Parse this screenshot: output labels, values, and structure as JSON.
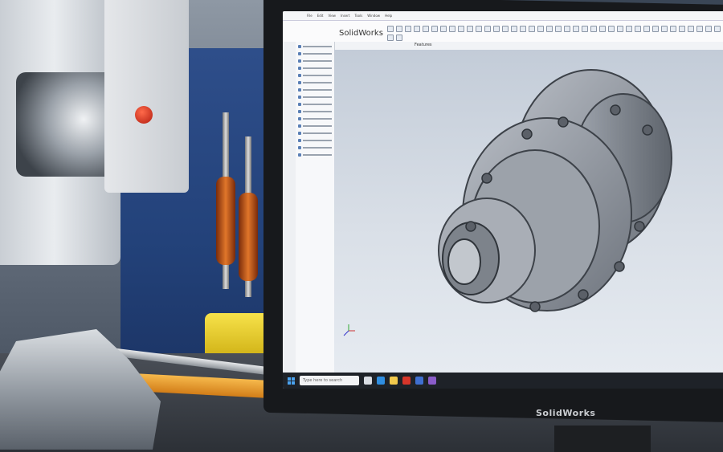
{
  "monitor": {
    "brand_label": "SolidWorks"
  },
  "app": {
    "title": "SolidWorks",
    "menu_items": [
      "File",
      "Edit",
      "View",
      "Insert",
      "Tools",
      "Window",
      "Help"
    ],
    "command_tab": "Features",
    "tree_rows": 16
  },
  "taskbar": {
    "search_placeholder": "Type here to search",
    "apps": [
      {
        "name": "task-view-icon",
        "color": "#d9dde3"
      },
      {
        "name": "browser-icon",
        "color": "#2f8ee0"
      },
      {
        "name": "file-explorer-icon",
        "color": "#f2c94c"
      },
      {
        "name": "solidworks-icon",
        "color": "#d7362a"
      },
      {
        "name": "app-icon",
        "color": "#3f6fd0"
      },
      {
        "name": "app-icon-2",
        "color": "#8a5cc9"
      }
    ]
  },
  "colors": {
    "viewport_top": "#c3ccd8",
    "part_gray": "#8d939c",
    "accent_red": "#d7362a"
  }
}
